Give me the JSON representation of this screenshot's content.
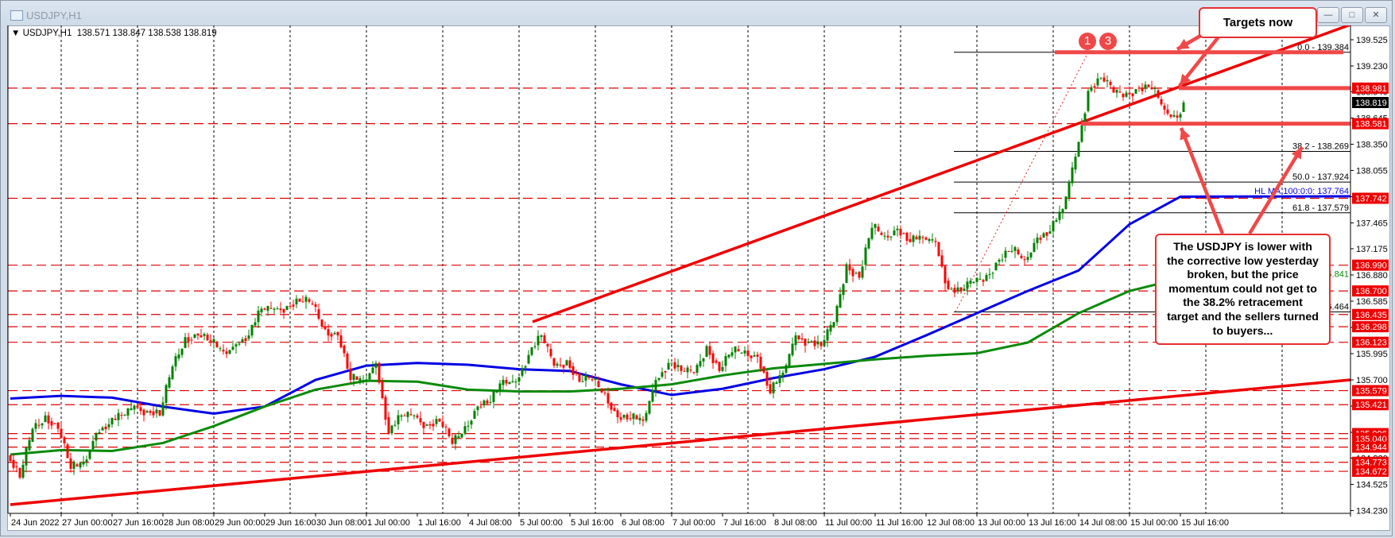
{
  "window": {
    "title": "USDJPY,H1",
    "buttons": [
      "minimize",
      "maximize",
      "close"
    ]
  },
  "header": {
    "symbol": "USDJPY,H1",
    "ohlc": "138.571 138.847 138.538 138.819"
  },
  "colors": {
    "bull": "#008000",
    "bear": "#ff0000",
    "level": "#e00000",
    "ma100": "#0000e6",
    "ma200": "#0a8a0a",
    "annotation": "#f04848"
  },
  "chart_data": {
    "type": "candlestick",
    "timeframe": "H1",
    "symbol": "USDJPY",
    "ylim": [
      134.23,
      139.62
    ],
    "grid": "vertical dotted",
    "y_ticks": [
      "139.525",
      "139.230",
      "138.940",
      "138.645",
      "138.350",
      "138.055",
      "137.760",
      "137.465",
      "137.175",
      "136.880",
      "136.585",
      "136.290",
      "135.995",
      "135.700",
      "135.405",
      "135.110",
      "134.820",
      "134.525",
      "134.230"
    ],
    "x_ticks": [
      "24 Jun 2022",
      "27 Jun 00:00",
      "27 Jun 16:00",
      "28 Jun 08:00",
      "29 Jun 00:00",
      "29 Jun 16:00",
      "30 Jun 08:00",
      "1 Jul 00:00",
      "1 Jul 16:00",
      "4 Jul 08:00",
      "5 Jul 00:00",
      "5 Jul 16:00",
      "6 Jul 08:00",
      "7 Jul 00:00",
      "7 Jul 16:00",
      "8 Jul 08:00",
      "11 Jul 00:00",
      "11 Jul 16:00",
      "12 Jul 08:00",
      "13 Jul 00:00",
      "13 Jul 16:00",
      "14 Jul 08:00",
      "15 Jul 00:00",
      "15 Jul 16:00"
    ],
    "first_open": 134.85,
    "closes_4h": [
      134.6,
      135.15,
      135.3,
      135.15,
      134.7,
      134.78,
      135.1,
      135.2,
      135.3,
      135.41,
      135.35,
      135.3,
      135.85,
      136.18,
      136.2,
      136.12,
      136.02,
      136.1,
      136.2,
      136.5,
      136.5,
      136.53,
      136.58,
      136.55,
      136.27,
      136.2,
      135.7,
      135.7,
      135.89,
      135.1,
      135.3,
      135.3,
      135.2,
      135.23,
      134.98,
      135.18,
      135.4,
      135.45,
      135.7,
      135.68,
      135.98,
      136.2,
      135.86,
      135.92,
      135.68,
      135.7,
      135.55,
      135.28,
      135.26,
      135.24,
      135.7,
      135.89,
      135.8,
      135.78,
      136.08,
      135.8,
      136.01,
      136.03,
      135.96,
      135.55,
      135.78,
      136.2,
      136.13,
      136.08,
      136.35,
      137.0,
      136.85,
      137.41,
      137.32,
      137.4,
      137.25,
      137.3,
      137.25,
      136.72,
      136.7,
      136.8,
      136.88,
      137.05,
      137.15,
      137.05,
      137.3,
      137.37,
      137.62,
      138.21,
      138.95,
      139.1,
      138.93,
      138.93,
      138.98,
      138.97,
      138.74,
      138.65,
      138.819
    ],
    "last_price": "138.819",
    "series": [
      {
        "name": "HL MA:100:0:0",
        "at_x_ticks": [
          135.49,
          135.52,
          135.5,
          135.4,
          135.32,
          135.4,
          135.7,
          135.86,
          135.89,
          135.87,
          135.82,
          135.8,
          135.65,
          135.53,
          135.6,
          135.72,
          135.82,
          135.96,
          136.2,
          136.45,
          136.7,
          136.93,
          137.45,
          137.76
        ],
        "label": "HL MA:100:0:0: 137.764"
      },
      {
        "at_x_ticks": [
          134.86,
          134.91,
          134.9,
          134.99,
          135.18,
          135.4,
          135.59,
          135.69,
          135.68,
          135.59,
          135.57,
          135.57,
          135.6,
          135.65,
          135.75,
          135.83,
          135.88,
          135.93,
          135.97,
          136.0,
          136.12,
          136.45,
          136.7,
          136.84
        ],
        "label": "136.841"
      }
    ],
    "levels": [
      "138.981",
      "138.581",
      "137.742",
      "136.990",
      "136.700",
      "136.435",
      "136.298",
      "136.123",
      "135.579",
      "135.421",
      "135.096",
      "135.040",
      "134.944",
      "134.773",
      "134.672"
    ],
    "fibonacci": [
      {
        "label": "0.0 - 139.384",
        "price": 139.384
      },
      {
        "label": "38.2 - 138.269",
        "price": 138.269
      },
      {
        "label": "50.0 - 137.924",
        "price": 137.924
      },
      {
        "label": "61.8 - 137.579",
        "price": 137.579
      },
      {
        "label": "100.0 - 136.464",
        "price": 136.464
      }
    ],
    "trendlines": [
      {
        "from": [
          "5 Jul 00:00",
          136.35
        ],
        "to": [
          "right edge",
          139.55
        ]
      },
      {
        "from": [
          "24 Jun 2022",
          134.3
        ],
        "to": [
          "right edge",
          135.7
        ]
      }
    ]
  },
  "annotations": {
    "badges": [
      "1",
      "3"
    ],
    "targets": "Targets now",
    "main_lines": [
      "The USDJPY is lower with",
      "the corrective low yesterday",
      "broken, but the price",
      "momentum could not get to",
      "the 38.2% retracement",
      "target and the sellers turned",
      "to buyers..."
    ]
  }
}
